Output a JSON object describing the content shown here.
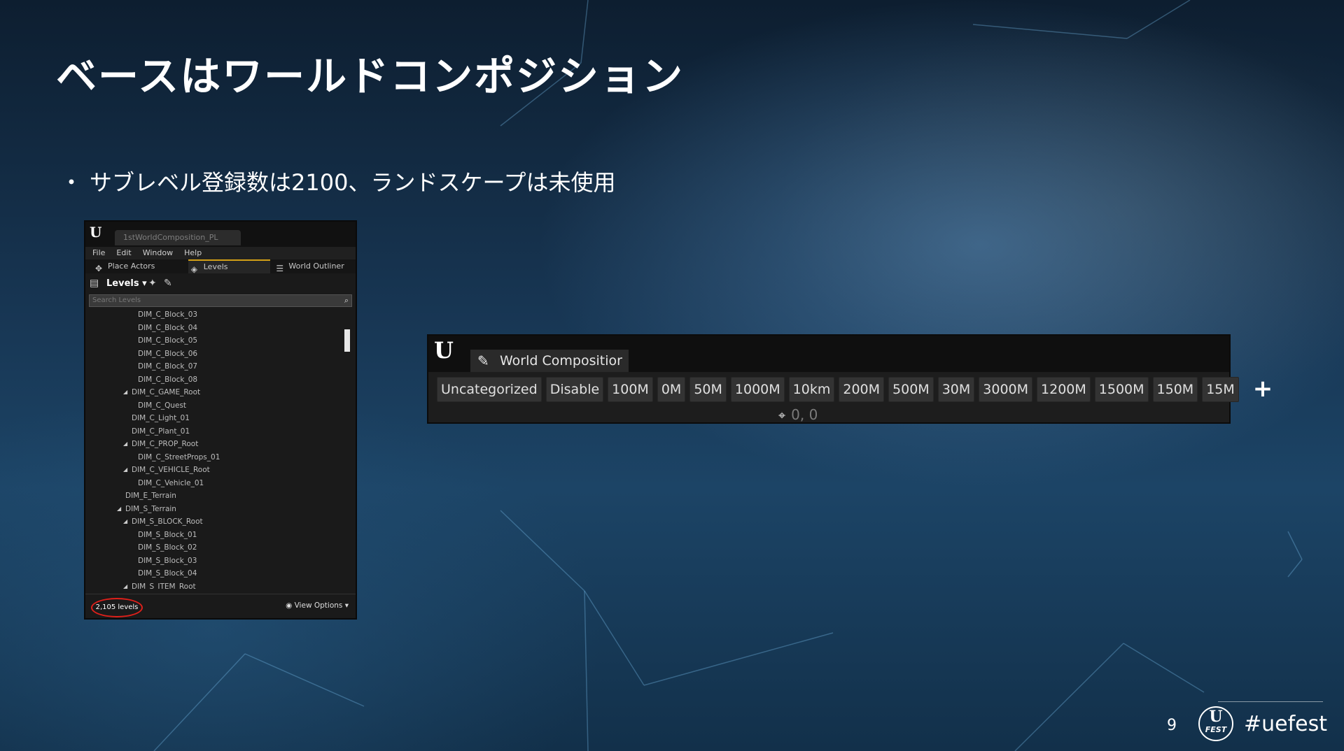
{
  "slide": {
    "title": "ベースはワールドコンポジション",
    "bullet_mark": "・",
    "bullet": "サブレベル登録数は2100、ランドスケープは未使用",
    "page_number": "9",
    "hashtag": "#uefest",
    "logo_letter": "U",
    "logo_sub": "FEST"
  },
  "levels_window": {
    "logo": "U",
    "tab_title": "1stWorldComposition_PL",
    "menu": [
      "File",
      "Edit",
      "Window",
      "Help"
    ],
    "tabs": [
      "Place Actors",
      "Levels",
      "World Outliner"
    ],
    "toolbar_label": "Levels ▾",
    "search_placeholder": "Search Levels",
    "rows": [
      {
        "label": "DIM_C_Block_03",
        "depth": 2,
        "expanded": false
      },
      {
        "label": "DIM_C_Block_04",
        "depth": 2,
        "expanded": false
      },
      {
        "label": "DIM_C_Block_05",
        "depth": 2,
        "expanded": false
      },
      {
        "label": "DIM_C_Block_06",
        "depth": 2,
        "expanded": false
      },
      {
        "label": "DIM_C_Block_07",
        "depth": 2,
        "expanded": false
      },
      {
        "label": "DIM_C_Block_08",
        "depth": 2,
        "expanded": false
      },
      {
        "label": "DIM_C_GAME_Root",
        "depth": 1,
        "expanded": true
      },
      {
        "label": "DIM_C_Quest",
        "depth": 2,
        "expanded": false
      },
      {
        "label": "DIM_C_Light_01",
        "depth": 1,
        "expanded": false
      },
      {
        "label": "DIM_C_Plant_01",
        "depth": 1,
        "expanded": false
      },
      {
        "label": "DIM_C_PROP_Root",
        "depth": 1,
        "expanded": true
      },
      {
        "label": "DIM_C_StreetProps_01",
        "depth": 2,
        "expanded": false
      },
      {
        "label": "DIM_C_VEHICLE_Root",
        "depth": 1,
        "expanded": true
      },
      {
        "label": "DIM_C_Vehicle_01",
        "depth": 2,
        "expanded": false
      },
      {
        "label": "DIM_E_Terrain",
        "depth": 0,
        "expanded": false
      },
      {
        "label": "DIM_S_Terrain",
        "depth": 0,
        "expanded": true
      },
      {
        "label": "DIM_S_BLOCK_Root",
        "depth": 1,
        "expanded": true
      },
      {
        "label": "DIM_S_Block_01",
        "depth": 2,
        "expanded": false
      },
      {
        "label": "DIM_S_Block_02",
        "depth": 2,
        "expanded": false
      },
      {
        "label": "DIM_S_Block_03",
        "depth": 2,
        "expanded": false
      },
      {
        "label": "DIM_S_Block_04",
        "depth": 2,
        "expanded": false
      },
      {
        "label": "DIM_S_ITEM_Root",
        "depth": 1,
        "expanded": true
      }
    ],
    "level_count": "2,105 levels",
    "view_options": "View Options ▾"
  },
  "world_composition": {
    "logo": "U",
    "tab_label": "World Compositior",
    "layers": [
      "Uncategorized",
      "Disable",
      "100M",
      "0M",
      "50M",
      "1000M",
      "10km",
      "200M",
      "500M",
      "30M",
      "3000M",
      "1200M",
      "1500M",
      "150M",
      "15M"
    ],
    "add_label": "+",
    "coordinates": "0, 0"
  },
  "icons": {
    "place_actors": "place-actors-icon",
    "levels": "levels-icon",
    "world_outliner": "world-outliner-icon",
    "search": "search-icon",
    "eye": "eye-icon",
    "brush": "brush-icon",
    "crosshair": "crosshair-icon"
  },
  "colors": {
    "highlight_circle": "#e0201a",
    "active_tab_accent": "#d4a017",
    "panel_bg": "#1a1a1a"
  }
}
